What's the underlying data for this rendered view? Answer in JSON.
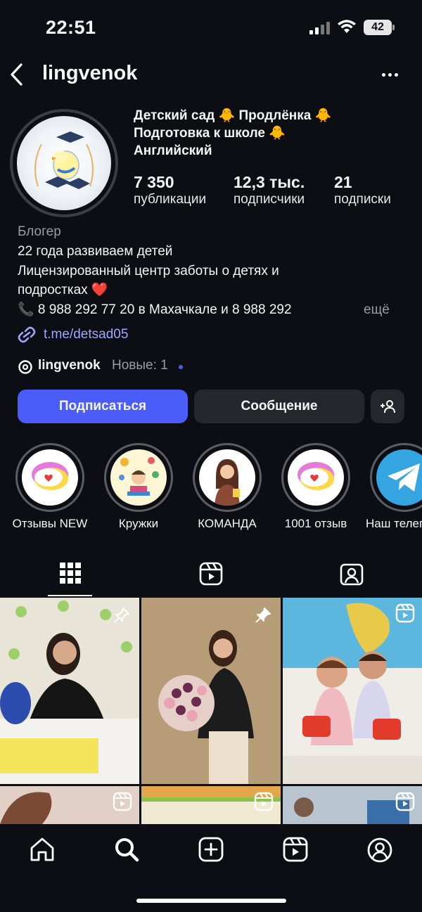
{
  "status": {
    "time": "22:51",
    "battery": "42"
  },
  "header": {
    "username": "lingvenok"
  },
  "profile": {
    "bio_line1": "Детский сад 🐥 Продлёнка 🐥",
    "bio_line2": "Подготовка к школе 🐥",
    "bio_line3": "Английский",
    "stats": [
      {
        "value": "7 350",
        "label": "публикации"
      },
      {
        "value": "12,3 тыс.",
        "label": "подписчики"
      },
      {
        "value": "21",
        "label": "подписки"
      }
    ],
    "category": "Блогер",
    "desc_line1": "22 года развиваем детей",
    "desc_line2": "Лицензированный центр заботы о детях и",
    "desc_line3": "подростках ❤️",
    "desc_line4": "📞 8 988 292 77 20 в Махачкале и 8 988 292",
    "more": "ещё",
    "link": "t.me/detsad05",
    "threads_name": "lingvenok",
    "threads_new": "Новые: 1"
  },
  "buttons": {
    "follow": "Подписаться",
    "message": "Сообщение"
  },
  "highlights": [
    {
      "label": "Отзывы NEW"
    },
    {
      "label": "Кружки"
    },
    {
      "label": "КОМАНДА"
    },
    {
      "label": "1001 отзыв"
    },
    {
      "label": "Наш телеграм"
    }
  ],
  "colors": {
    "accent": "#4a5df9",
    "background": "#0c0e13",
    "secondary_button": "#25272d"
  }
}
